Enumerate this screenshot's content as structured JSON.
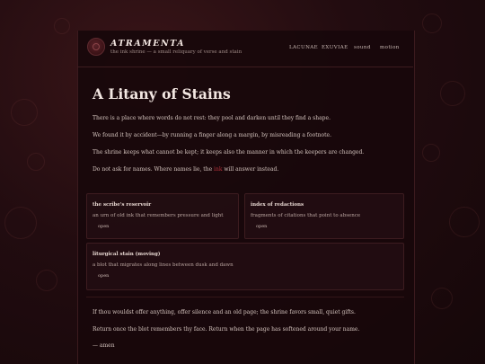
{
  "brand": {
    "name": "ATRAMENTA",
    "tagline": "the ink shrine — a small reliquary of verse and stain"
  },
  "nav": {
    "items": [
      "LACUNAE",
      "EXUVIAE",
      "sound",
      "motion"
    ]
  },
  "page": {
    "title": "A Litany of Stains",
    "paragraphs": [
      "There is a place where words do not rest: they pool and darken until they find a shape.",
      "We found it by accident—by running a finger along a margin, by misreading a footnote.",
      "The shrine keeps what cannot be kept; it keeps also the manner in which the keepers are changed."
    ],
    "names_line": {
      "before": "Do not ask for names. Where names lie, the ",
      "ink_word": "ink",
      "after": " will answer instead."
    }
  },
  "cards": [
    {
      "title": "the scribe's reservoir",
      "desc": "an urn of old ink that remembers pressure and light",
      "open": "open"
    },
    {
      "title": "index of redactions",
      "desc": "fragments of citations that point to absence",
      "open": "open"
    },
    {
      "title": "liturgical stain (moving)",
      "desc": "a blot that migrates along lines between dusk and dawn",
      "open": "open"
    }
  ],
  "closing": [
    "If thou wouldst offer anything, offer silence and an old page; the shrine favors small, quiet gifts.",
    "Return once the blot remembers thy face. Return when the page has softened around your name.",
    "— amen"
  ],
  "colors": {
    "background": "#220c10",
    "accent_ink": "#b3323b",
    "text": "#d4c4be"
  }
}
